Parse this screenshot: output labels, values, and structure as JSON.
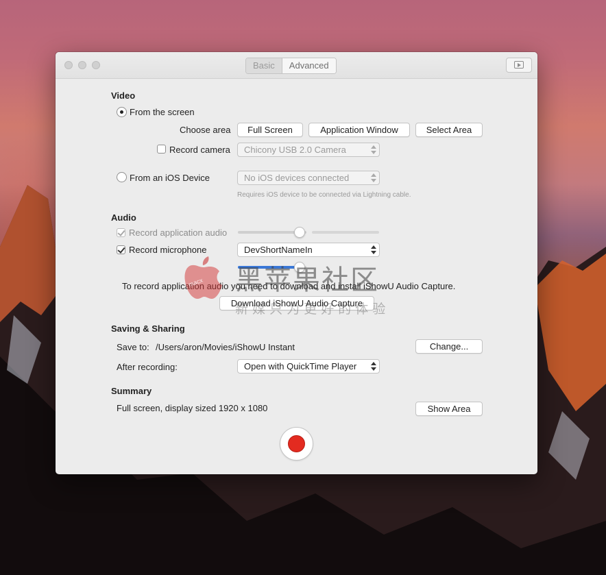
{
  "window": {
    "tabs": [
      "Basic",
      "Advanced"
    ],
    "selected_tab": "Basic"
  },
  "video": {
    "heading": "Video",
    "from_screen_label": "From the screen",
    "choose_area_label": "Choose area",
    "area_buttons": [
      "Full Screen",
      "Application Window",
      "Select Area"
    ],
    "record_camera_label": "Record camera",
    "camera_value": "Chicony USB 2.0 Camera",
    "from_ios_label": "From an iOS Device",
    "ios_value": "No iOS devices connected",
    "ios_hint": "Requires iOS device to be connected via Lightning cable."
  },
  "audio": {
    "heading": "Audio",
    "record_app_audio_label": "Record application audio",
    "record_app_audio_checked": true,
    "app_audio_level": 0.9,
    "record_mic_label": "Record microphone",
    "record_mic_checked": true,
    "mic_value": "DevShortNameIn",
    "mic_level": 0.9,
    "install_notice": "To record application audio you need to download and install iShowU Audio Capture.",
    "download_button": "Download iShowU Audio Capture"
  },
  "saving": {
    "heading": "Saving & Sharing",
    "save_to_label": "Save to:",
    "save_path": "/Users/aron/Movies/iShowU Instant",
    "change_button": "Change...",
    "after_recording_label": "After recording:",
    "after_recording_value": "Open with QuickTime Player"
  },
  "summary": {
    "heading": "Summary",
    "text": "Full screen, display sized 1920 x 1080",
    "show_area_button": "Show Area"
  },
  "watermark": {
    "title": "黑苹果社区",
    "subtitle": "新   媒   只   为   更   好   的   体   验",
    "logo_text": "macx"
  },
  "colors": {
    "record": "#e32b20",
    "slider_fill": "#3a78d8"
  }
}
